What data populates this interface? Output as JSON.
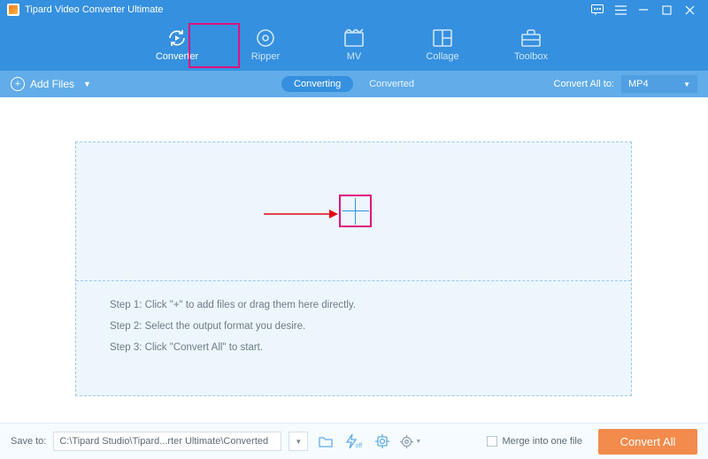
{
  "title": "Tipard Video Converter Ultimate",
  "tabs": [
    {
      "label": "Converter"
    },
    {
      "label": "Ripper"
    },
    {
      "label": "MV"
    },
    {
      "label": "Collage"
    },
    {
      "label": "Toolbox"
    }
  ],
  "toolbar": {
    "add_files_label": "Add Files",
    "converting_label": "Converting",
    "converted_label": "Converted",
    "convert_all_to_label": "Convert All to:",
    "format_selected": "MP4"
  },
  "steps": {
    "s1": "Step 1: Click \"+\" to add files or drag them here directly.",
    "s2": "Step 2: Select the output format you desire.",
    "s3": "Step 3: Click \"Convert All\" to start."
  },
  "bottom": {
    "save_to_label": "Save to:",
    "path": "C:\\Tipard Studio\\Tipard...rter Ultimate\\Converted",
    "merge_label": "Merge into one file",
    "convert_all_btn": "Convert All"
  }
}
